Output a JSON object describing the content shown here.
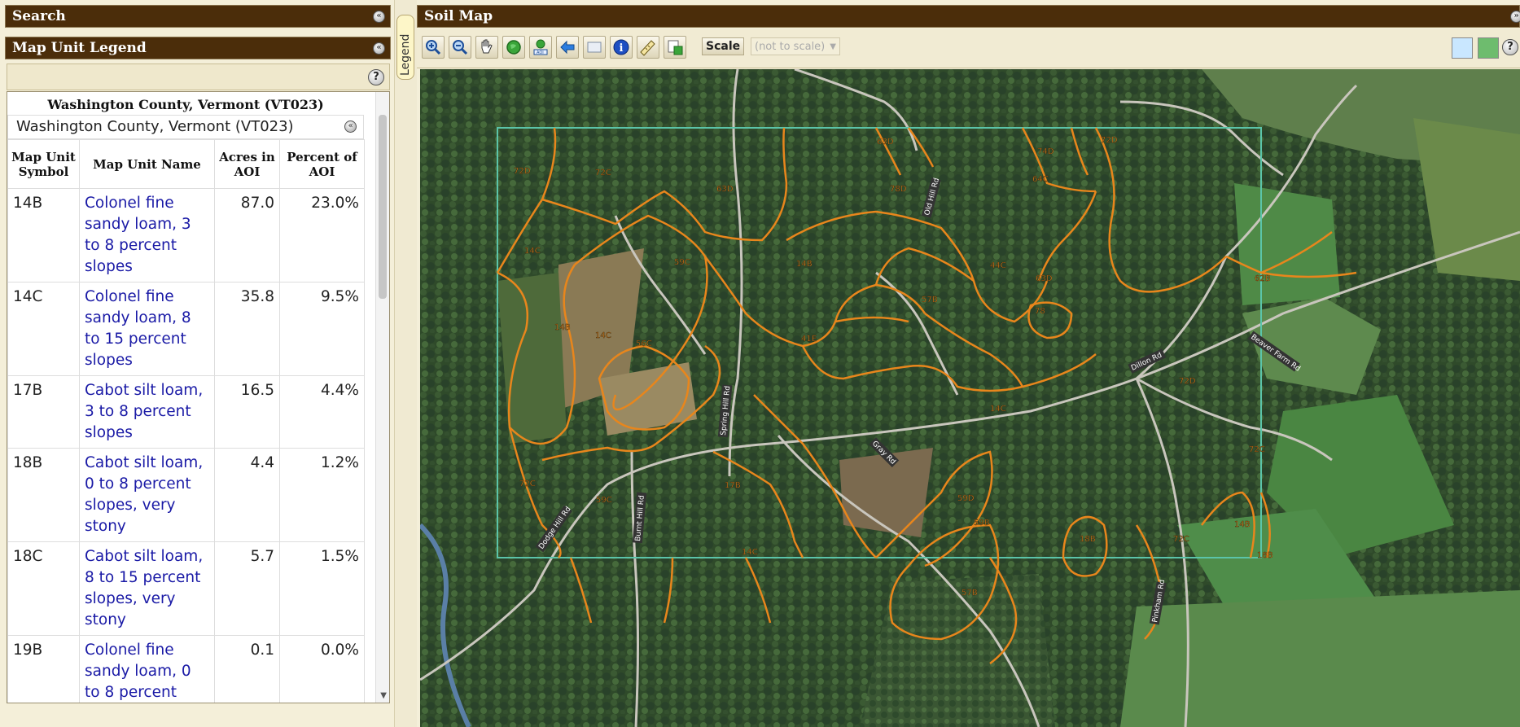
{
  "search_panel": {
    "title": "Search"
  },
  "legend_panel": {
    "title": "Map Unit Legend",
    "county_header": "Washington County, Vermont (VT023)",
    "county_subheader": "Washington County, Vermont (VT023)",
    "columns": [
      "Map Unit Symbol",
      "Map Unit Name",
      "Acres in AOI",
      "Percent of AOI"
    ],
    "rows": [
      {
        "symbol": "14B",
        "name": "Colonel fine sandy loam, 3 to 8 percent slopes",
        "acres": "87.0",
        "percent": "23.0%"
      },
      {
        "symbol": "14C",
        "name": "Colonel fine sandy loam, 8 to 15 percent slopes",
        "acres": "35.8",
        "percent": "9.5%"
      },
      {
        "symbol": "17B",
        "name": "Cabot silt loam, 3 to 8 percent slopes",
        "acres": "16.5",
        "percent": "4.4%"
      },
      {
        "symbol": "18B",
        "name": "Cabot silt loam, 0 to 8 percent slopes, very stony",
        "acres": "4.4",
        "percent": "1.2%"
      },
      {
        "symbol": "18C",
        "name": "Cabot silt loam, 8 to 15 percent slopes, very stony",
        "acres": "5.7",
        "percent": "1.5%"
      },
      {
        "symbol": "19B",
        "name": "Colonel fine sandy loam, 0 to 8 percent",
        "acres": "0.1",
        "percent": "0.0%"
      }
    ]
  },
  "legend_tab": {
    "label": "Legend"
  },
  "map_panel": {
    "title": "Soil Map",
    "scale_label": "Scale",
    "scale_value": "(not to scale)",
    "tools": [
      "zoom-in-icon",
      "zoom-out-icon",
      "pan-hand-icon",
      "full-extent-icon",
      "zoom-to-aoi-icon",
      "previous-extent-icon",
      "next-extent-icon",
      "identify-icon",
      "measure-icon",
      "clear-icon"
    ],
    "map_labels": [
      {
        "t": "72D"
      },
      {
        "t": "72C"
      },
      {
        "t": "63D"
      },
      {
        "t": "63D"
      },
      {
        "t": "78D"
      },
      {
        "t": "74D"
      },
      {
        "t": "64C"
      },
      {
        "t": "72D"
      },
      {
        "t": "14C"
      },
      {
        "t": "14B"
      },
      {
        "t": "14C"
      },
      {
        "t": "59C"
      },
      {
        "t": "56C"
      },
      {
        "t": "14B"
      },
      {
        "t": "44C"
      },
      {
        "t": "63D"
      },
      {
        "t": "78"
      },
      {
        "t": "57B"
      },
      {
        "t": "41E"
      },
      {
        "t": "62B"
      },
      {
        "t": "14C"
      },
      {
        "t": "72D"
      },
      {
        "t": "72C"
      },
      {
        "t": "59C"
      },
      {
        "t": "17B"
      },
      {
        "t": "59D"
      },
      {
        "t": "14B"
      },
      {
        "t": "72C"
      },
      {
        "t": "18B"
      },
      {
        "t": "72C"
      },
      {
        "t": "57B"
      },
      {
        "t": "59B"
      },
      {
        "t": "14C"
      },
      {
        "t": "18B"
      }
    ],
    "road_labels": [
      {
        "t": "Dodge Hill Rd"
      },
      {
        "t": "Burnt Hill Rd"
      },
      {
        "t": "Dillon Rd"
      },
      {
        "t": "Gray Rd"
      },
      {
        "t": "Spring Hill Rd"
      },
      {
        "t": "Beaver Farm Rd"
      },
      {
        "t": "Pinkham Rd"
      },
      {
        "t": "Old Hill Rd"
      }
    ]
  }
}
